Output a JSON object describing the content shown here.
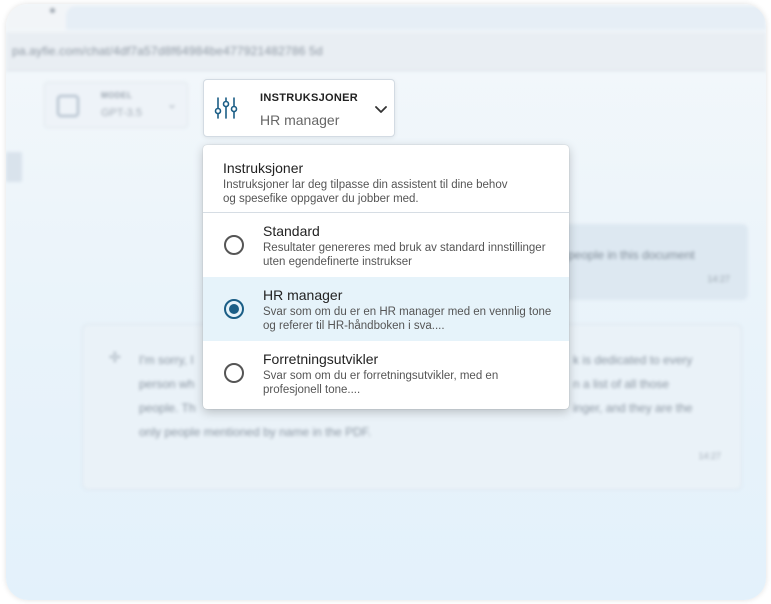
{
  "browser": {
    "url": "pa.ayfie.com/chat/4df7a57d8f64984be477921482786 5d"
  },
  "toolbar": {
    "model_label": "MODEL",
    "model_value": "GPT-3.5",
    "instructions_label": "INSTRUKSJONER",
    "instructions_value": "HR manager",
    "instructions_icon": "sliders-icon"
  },
  "menu": {
    "title": "Instruksjoner",
    "description": "Instruksjoner lar deg tilpasse din assistent til dine behov og spesefike oppgaver du jobber med.",
    "options": [
      {
        "title": "Standard",
        "description": "Resultater genereres med bruk av standard innstillinger uten egendefinerte instrukser",
        "selected": false
      },
      {
        "title": "HR manager",
        "description": "Svar som om du er en HR manager med en vennlig tone og referer til HR-håndboken i sva....",
        "selected": true
      },
      {
        "title": "Forretningsutvikler",
        "description": "Svar som om du er forretningsutvikler, med en profesjonell tone....",
        "selected": false
      }
    ]
  },
  "chat": {
    "user_message": "people in this document",
    "user_time": "14:27",
    "ai_lines": [
      "I'm sorry, I",
      "person wh",
      "people. Th",
      "only people mentioned by name in the PDF."
    ],
    "ai_right_lines": [
      "k is dedicated to every",
      "n a list of all those",
      "inger, and they are the"
    ],
    "ai_time": "14:27"
  },
  "colors": {
    "accent": "#1b5e86",
    "selected_bg": "#e6f3fa"
  }
}
